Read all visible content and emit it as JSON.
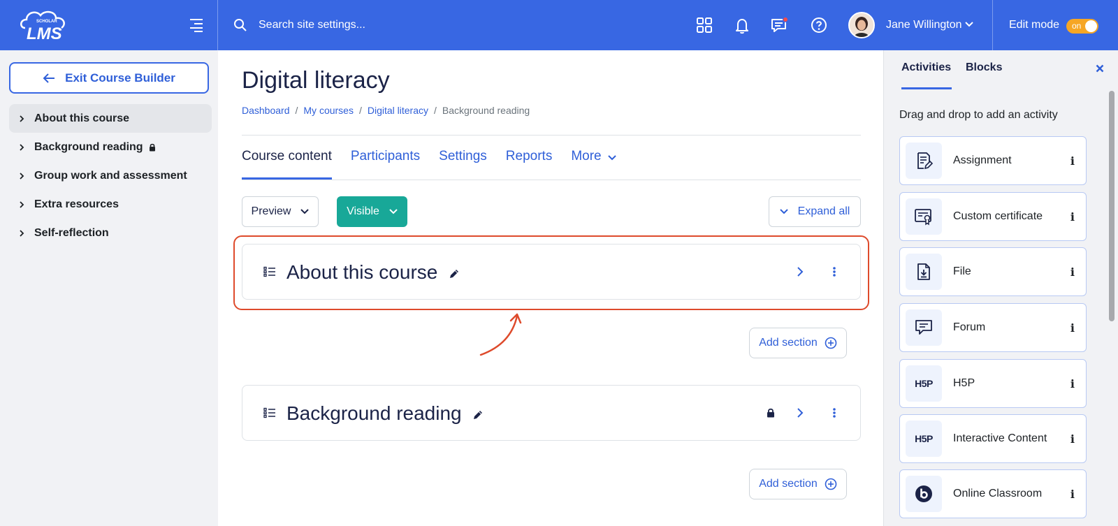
{
  "topbar": {
    "logo_small_text": "SCHOLAR",
    "logo_text": "LMS",
    "search_placeholder": "Search site settings...",
    "user_name": "Jane Willington",
    "edit_mode_label": "Edit mode",
    "edit_mode_state": "on",
    "colors": {
      "bar": "#3867e3",
      "toggle": "#f6a625",
      "notification_dot": "#f34b4b"
    }
  },
  "sidebar": {
    "exit_label": "Exit Course Builder",
    "items": [
      {
        "label": "About this course",
        "active": true,
        "locked": false
      },
      {
        "label": "Background reading",
        "active": false,
        "locked": true
      },
      {
        "label": "Group work and assessment",
        "active": false,
        "locked": false
      },
      {
        "label": "Extra resources",
        "active": false,
        "locked": false
      },
      {
        "label": "Self-reflection",
        "active": false,
        "locked": false
      }
    ]
  },
  "main": {
    "title": "Digital literacy",
    "breadcrumb": [
      "Dashboard",
      "My courses",
      "Digital literacy",
      "Background reading"
    ],
    "tabs": [
      "Course content",
      "Participants",
      "Settings",
      "Reports",
      "More"
    ],
    "preview_label": "Preview",
    "visible_label": "Visible",
    "expand_label": "Expand all",
    "sections": [
      {
        "title": "About this course",
        "locked": false
      },
      {
        "title": "Background reading",
        "locked": true
      }
    ],
    "add_section_label": "Add section",
    "colors": {
      "visible_button": "#18a898",
      "highlight": "#de4a2b",
      "link": "#2f5fd8"
    }
  },
  "drawer": {
    "tabs": [
      "Activities",
      "Blocks"
    ],
    "hint": "Drag and drop to add an activity",
    "activities": [
      {
        "name": "Assignment",
        "icon": "assignment-icon"
      },
      {
        "name": "Custom certificate",
        "icon": "certificate-icon"
      },
      {
        "name": "File",
        "icon": "file-icon"
      },
      {
        "name": "Forum",
        "icon": "forum-icon"
      },
      {
        "name": "H5P",
        "icon": "h5p-icon"
      },
      {
        "name": "Interactive Content",
        "icon": "h5p-icon"
      },
      {
        "name": "Online Classroom",
        "icon": "bigbluebutton-icon"
      }
    ],
    "h5p_glyph": "H5P",
    "info_glyph": "i"
  }
}
